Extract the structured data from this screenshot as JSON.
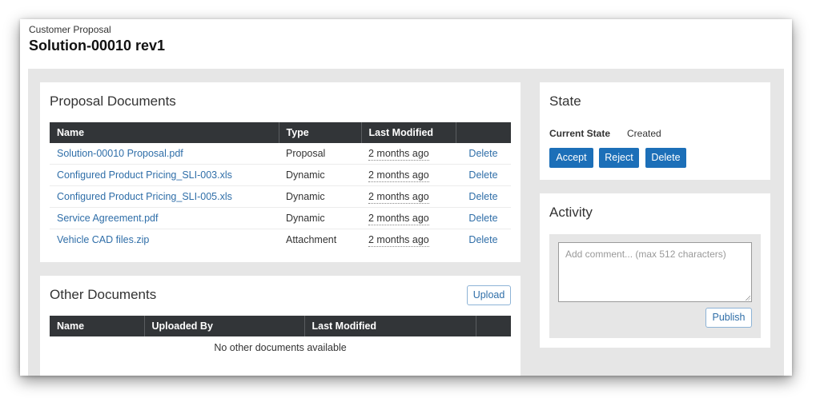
{
  "header": {
    "breadcrumb": "Customer Proposal",
    "title": "Solution-00010 rev1"
  },
  "proposal_documents": {
    "title": "Proposal Documents",
    "columns": [
      "Name",
      "Type",
      "Last Modified",
      ""
    ],
    "rows": [
      {
        "name": "Solution-00010 Proposal.pdf",
        "type": "Proposal",
        "modified": "2 months ago",
        "action": "Delete"
      },
      {
        "name": "Configured Product Pricing_SLI-003.xls",
        "type": "Dynamic",
        "modified": "2 months ago",
        "action": "Delete"
      },
      {
        "name": "Configured Product Pricing_SLI-005.xls",
        "type": "Dynamic",
        "modified": "2 months ago",
        "action": "Delete"
      },
      {
        "name": "Service Agreement.pdf",
        "type": "Dynamic",
        "modified": "2 months ago",
        "action": "Delete"
      },
      {
        "name": "Vehicle CAD files.zip",
        "type": "Attachment",
        "modified": "2 months ago",
        "action": "Delete"
      }
    ]
  },
  "other_documents": {
    "title": "Other Documents",
    "upload_label": "Upload",
    "columns": [
      "Name",
      "Uploaded By",
      "Last Modified",
      ""
    ],
    "empty_text": "No other documents available"
  },
  "state": {
    "title": "State",
    "current_state_label": "Current State",
    "current_state_value": "Created",
    "accept_label": "Accept",
    "reject_label": "Reject",
    "delete_label": "Delete",
    "button_color": "#1c6fb8"
  },
  "activity": {
    "title": "Activity",
    "comment_placeholder": "Add comment... (max 512 characters)",
    "publish_label": "Publish"
  }
}
